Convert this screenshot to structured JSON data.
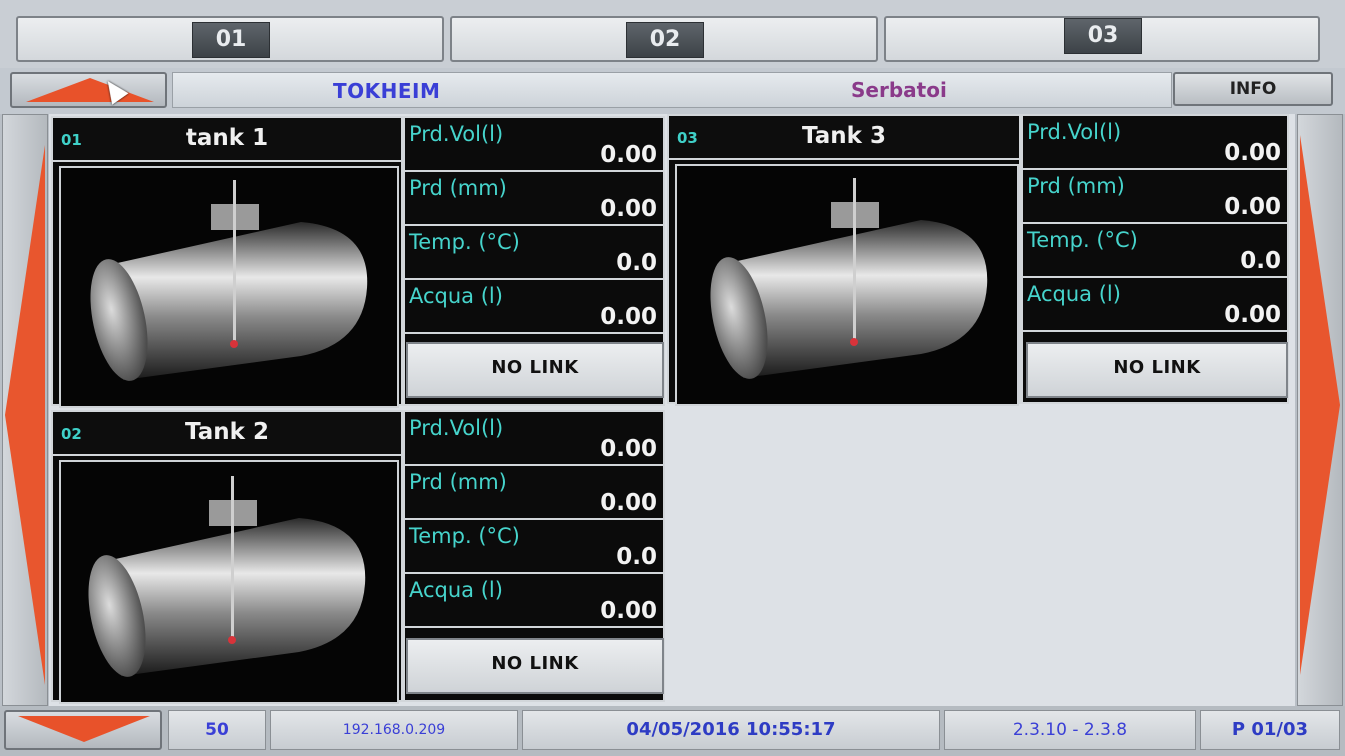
{
  "tabs": [
    {
      "label": "01"
    },
    {
      "label": "02"
    },
    {
      "label": "03"
    }
  ],
  "header": {
    "brand": "TOKHEIM",
    "title": "Serbatoi",
    "info_label": "INFO"
  },
  "tanks": [
    {
      "id": "01",
      "name": "tank 1",
      "fields": [
        {
          "label": "Prd.Vol(l)",
          "value": "0.00"
        },
        {
          "label": "Prd (mm)",
          "value": "0.00"
        },
        {
          "label": "Temp. (°C)",
          "value": "0.0"
        },
        {
          "label": "Acqua (l)",
          "value": "0.00"
        }
      ],
      "status": "NO LINK"
    },
    {
      "id": "03",
      "name": "Tank 3",
      "fields": [
        {
          "label": "Prd.Vol(l)",
          "value": "0.00"
        },
        {
          "label": "Prd (mm)",
          "value": "0.00"
        },
        {
          "label": "Temp. (°C)",
          "value": "0.0"
        },
        {
          "label": "Acqua (l)",
          "value": "0.00"
        }
      ],
      "status": "NO LINK"
    },
    {
      "id": "02",
      "name": "Tank 2",
      "fields": [
        {
          "label": "Prd.Vol(l)",
          "value": "0.00"
        },
        {
          "label": "Prd (mm)",
          "value": "0.00"
        },
        {
          "label": "Temp. (°C)",
          "value": "0.0"
        },
        {
          "label": "Acqua (l)",
          "value": "0.00"
        }
      ],
      "status": "NO LINK"
    }
  ],
  "footer": {
    "count": "50",
    "ip": "192.168.0.209",
    "datetime": "04/05/2016 10:55:17",
    "version": "2.3.10 - 2.3.8",
    "page": "P 01/03"
  },
  "icons": {
    "scroll_up": "arrow-up-icon",
    "scroll_down": "arrow-down-icon",
    "prev": "arrow-left-icon",
    "next": "arrow-right-icon",
    "cursor": "mouse-pointer-icon",
    "tank": "tank-image-icon"
  },
  "colors": {
    "accent_arrow": "#e8562e",
    "label_cyan": "#46d4cc",
    "brand_blue": "#3a3fd6",
    "title_purple": "#8a3a8a",
    "panel_black": "#0b0b0b"
  }
}
